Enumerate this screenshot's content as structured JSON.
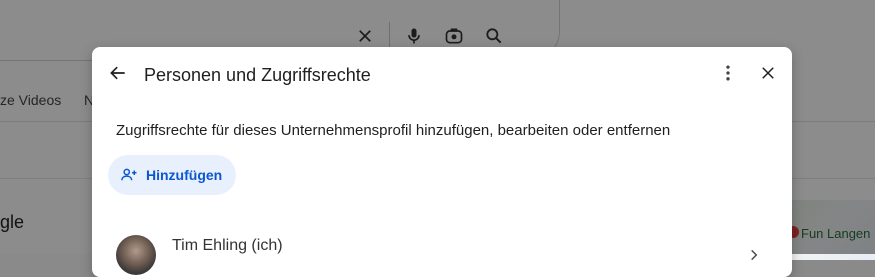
{
  "background": {
    "tab_videos": "ze Videos",
    "tab_n": "N",
    "left_text": "gle",
    "map_label": "Fun Langen"
  },
  "dialog": {
    "title": "Personen und Zugriffsrechte",
    "description": "Zugriffsrechte für dieses Unternehmensprofil hinzufügen, bearbeiten oder entfernen",
    "add_button_label": "Hinzufügen",
    "users": [
      {
        "name": "Tim Ehling (ich)"
      }
    ]
  },
  "icons": {
    "back": "arrow-left-icon",
    "more": "more-vert-icon",
    "close": "close-icon",
    "add_person": "person-add-icon",
    "chevron": "chevron-right-icon",
    "clear": "close-icon",
    "mic": "mic-icon",
    "lens": "camera-lens-icon",
    "search": "search-icon"
  },
  "colors": {
    "accent": "#0b57d0",
    "button_bg": "#e8f0fe",
    "scrim": "rgba(0,0,0,0.45)"
  }
}
